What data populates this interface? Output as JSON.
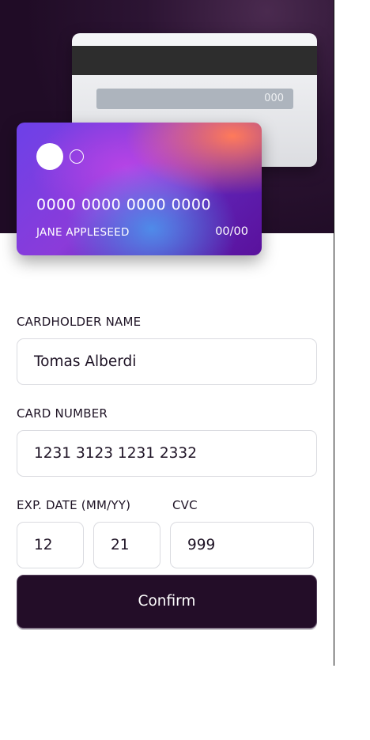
{
  "card_preview": {
    "back": {
      "cvc": "000"
    },
    "front": {
      "number": "0000 0000 0000 0000",
      "holder": "JANE APPLESEED",
      "expiry": "00/00"
    }
  },
  "form": {
    "name": {
      "label": "CARDHOLDER NAME",
      "value": "Tomas Alberdi"
    },
    "number": {
      "label": "CARD NUMBER",
      "value": "1231 3123 1231 2332"
    },
    "exp": {
      "label": "EXP. DATE (MM/YY)",
      "month": "12",
      "year": "21"
    },
    "cvc": {
      "label": "CVC",
      "value": "999"
    },
    "confirm_label": "Confirm"
  },
  "colors": {
    "hero_bg": "#200c26",
    "button_bg": "#230d28",
    "text_dark": "#1e1325",
    "border": "#dadbe0"
  }
}
